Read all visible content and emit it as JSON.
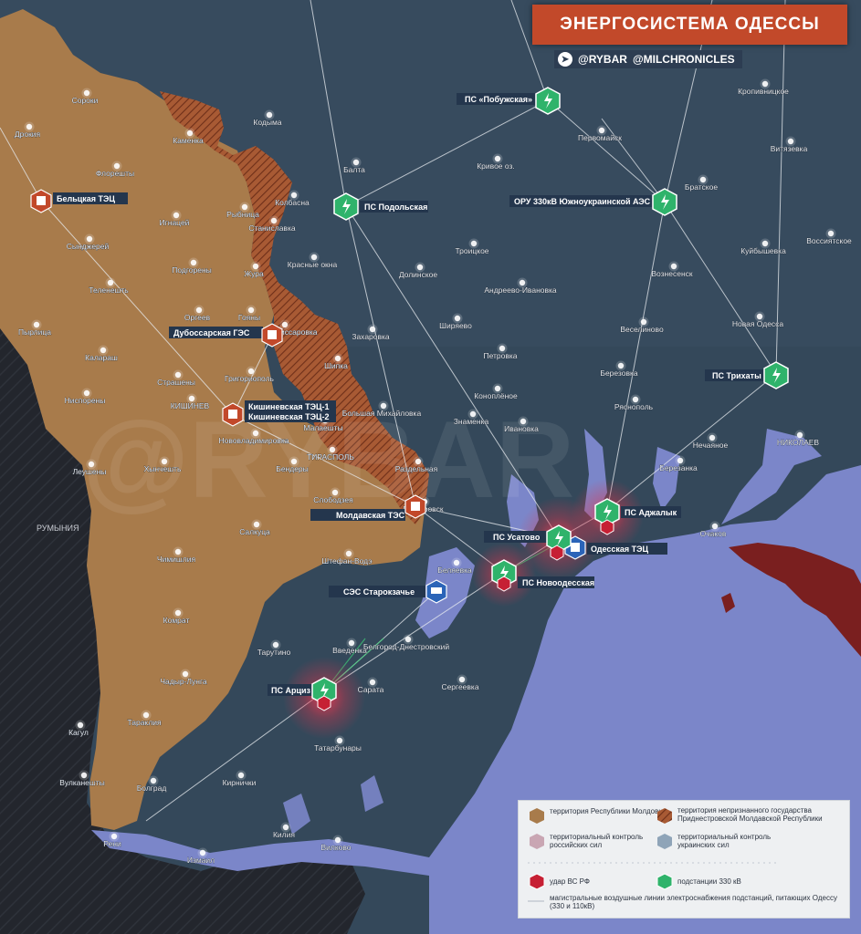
{
  "title": "ЭНЕРГОСИСТЕМА ОДЕССЫ",
  "handles": [
    "@RYBAR",
    "@MILCHRONICLES"
  ],
  "watermark": "@RYBAR",
  "country_label": "РУМЫНИЯ",
  "colors": {
    "moldova": "#a87b4b",
    "transnistria": "#a85a34",
    "russian_control": "#7a1f1f",
    "ukraine_land": "#34485a",
    "sea": "#7b86c9",
    "romania": "#23262d",
    "strike": "#e0344b",
    "substation": "#2fb36b",
    "line": "#e8ecf0"
  },
  "facilities": {
    "belcy_tec": "Бельцкая ТЭЦ",
    "dubossary_ges": "Дубоссарская ГЭС",
    "kishinev_tec1": "Кишиневская ТЭЦ-1",
    "kishinev_tec2": "Кишиневская ТЭЦ-2",
    "moldavskaya_tes": "Молдавская ТЭС",
    "ses_starokazache": "СЭС Старокзачье",
    "odesskaya_tec": "Одесская ТЭЦ"
  },
  "substations": {
    "pobuzhskaya": "ПС «Побужская»",
    "podolskaya": "ПС Подольская",
    "yuzhnoukr": "ОРУ 330кВ Южноукраинской АЭС",
    "trikhaty": "ПС Трихаты",
    "adzhalyk": "ПС Аджалык",
    "usatovo": "ПС Усатово",
    "novoodesskaya": "ПС Новоодесская",
    "artsiz": "ПС Арциз"
  },
  "cities": {
    "soroki": "Сороки",
    "drokiya": "Дрокия",
    "floreshty": "Флорешты",
    "kamenka": "Каменка",
    "kodyma": "Кодыма",
    "balta": "Балта",
    "krivoe_ozero": "Кривое оз.",
    "pervomaysk": "Первомайск",
    "kropivnitskoe": "Кропивницкое",
    "vitiazevka": "Витязевка",
    "bratskoe": "Братское",
    "kuybyshevka": "Куйбышевка",
    "vossiyatskoe": "Воссиятское",
    "voznesensk": "Вознесенск",
    "kolbasna": "Колбасна",
    "rybnitsa": "Рыбница",
    "stanislavka": "Станиславка",
    "ignatsey": "Игнацей",
    "syndzherey": "Сынджерей",
    "podgoreny": "Подгорены",
    "teleneshty": "Теленешть",
    "orgeev": "Оргеев",
    "zhura": "Жура",
    "krasnye_okna": "Красные окна",
    "dolinskoe": "Долинское",
    "troitskoe": "Троицкое",
    "andreevo_ivanovka": "Андреево-Ивановка",
    "pyrlitsa": "Пырлица",
    "goyany": "Гояны",
    "novokomissarovka": "Новокомиссаровка",
    "zakharovka": "Захаровка",
    "shiryaevo": "Ширяево",
    "veselinovo": "Веселиново",
    "novaya_odessa": "Новая Одесса",
    "kalarash": "Калараш",
    "strasheny": "Страшены",
    "grigoriopol": "Григориополь",
    "shipka": "Шипка",
    "petrovka": "Петровка",
    "berezovka": "Березовка",
    "nisporeny": "Ниспорены",
    "kishinev": "КИШИНЕВ",
    "konoplyanoe": "Коноплёное",
    "bolshaya_mikhailovka": "Большая Михайловка",
    "znamenka": "Знаменка",
    "ivanovka": "Ивановка",
    "ryasnopol": "Ряснополь",
    "malaeshty": "Малаешты",
    "novovladimirovka": "Нововладимировка",
    "nechayanoe": "Нечаяное",
    "nikolaev": "НИКОЛАЕВ",
    "tiraspol": "ТИРАСПОЛЬ",
    "bendery": "Бендеры",
    "razdelnaya": "Раздельная",
    "berezanka": "Березанка",
    "leusheny": "Леушены",
    "khyncheshty": "Хынчешть",
    "slobodzeya": "Слободзея",
    "dnestrovsk": "Днестровск",
    "ochakov": "Очаков",
    "salkutsa": "Салкуца",
    "chimishliya": "Чимишлия",
    "shtefan_voda": "Штефан-Водэ",
    "belyaevka": "Беляевка",
    "komrat": "Комрат",
    "tarutino": "Тарутино",
    "vvedenka": "Введенка",
    "belgorod_dnestrovsky": "Белгород-Днестровский",
    "chadyr_lunga": "Чадыр-Лунга",
    "sarata": "Сарата",
    "sergeevka": "Сергеевка",
    "tarakliya": "Тараклия",
    "kagul": "Кагул",
    "tatarbunary": "Татарбунары",
    "vulkaneshty": "Вулканешты",
    "bolgrad": "Болград",
    "kirnichki": "Кирнички",
    "reni": "Рени",
    "kiliya": "Килия",
    "izmail": "Измаил",
    "vilkovo": "Вилково"
  },
  "legend": {
    "moldova": "территория Республики Молдовия",
    "transnistria": "территория непризнанного государства Приднестровской Молдавской Республики",
    "russian_control": "территориальный контроль российских сил",
    "ukraine_control": "территориальный контроль украинских сил",
    "strike": "удар ВС РФ",
    "substation": "подстанции 330 кВ",
    "lines": "магистральные воздушные линии электроснабжения подстанций, питающих Одессу (330 и 110кВ)"
  }
}
